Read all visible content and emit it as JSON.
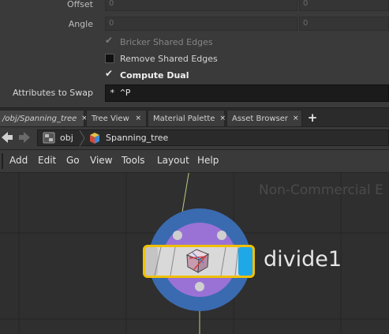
{
  "params": {
    "offset_label": "Offset",
    "offset_values": [
      "0",
      "0"
    ],
    "angle_label": "Angle",
    "angle_values": [
      "0",
      "0"
    ],
    "bricker_label": "Bricker Shared Edges",
    "bricker_checked": true,
    "remove_label": "Remove Shared Edges",
    "remove_checked": false,
    "dual_label": "Compute Dual",
    "dual_checked": true,
    "attr_label": "Attributes to Swap",
    "attr_value": "* ^P"
  },
  "tabs": [
    {
      "label": "/obj/Spanning_tree",
      "close": "×"
    },
    {
      "label": "Tree View",
      "close": "×"
    },
    {
      "label": "Material Palette",
      "close": "×"
    },
    {
      "label": "Asset Browser",
      "close": "×"
    }
  ],
  "tab_add": "+",
  "path": {
    "root": "obj",
    "current": "Spanning_tree"
  },
  "menu": [
    "Add",
    "Edit",
    "Go",
    "View",
    "Tools",
    "Layout",
    "Help"
  ],
  "network": {
    "watermark": "Non-Commercial E",
    "node_name": "divide1",
    "node_icon": "divide-cube-icon",
    "colors": {
      "outer_ring": "#3a6bb0",
      "inner_ring": "#9a72d6",
      "node_outline": "#f0c000",
      "display_flag": "#1ea8e8"
    }
  }
}
